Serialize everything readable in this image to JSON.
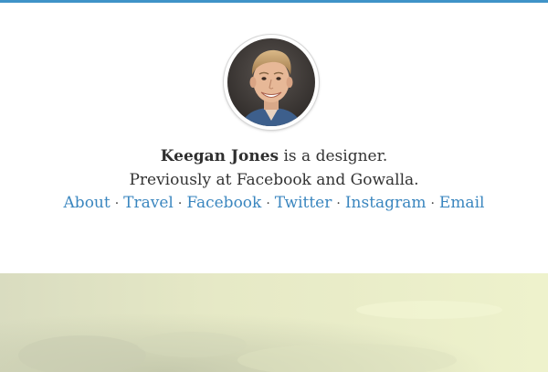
{
  "person": {
    "name": "Keegan Jones",
    "tagline": "is a designer.",
    "previously": "Previously at Facebook and Gowalla."
  },
  "nav": [
    {
      "label": "About"
    },
    {
      "label": "Travel"
    },
    {
      "label": "Facebook"
    },
    {
      "label": "Twitter"
    },
    {
      "label": "Instagram"
    },
    {
      "label": "Email"
    }
  ],
  "separator": "·",
  "colors": {
    "accent_bar": "#3f93c8",
    "link": "#3a86bf",
    "text": "#333333"
  }
}
